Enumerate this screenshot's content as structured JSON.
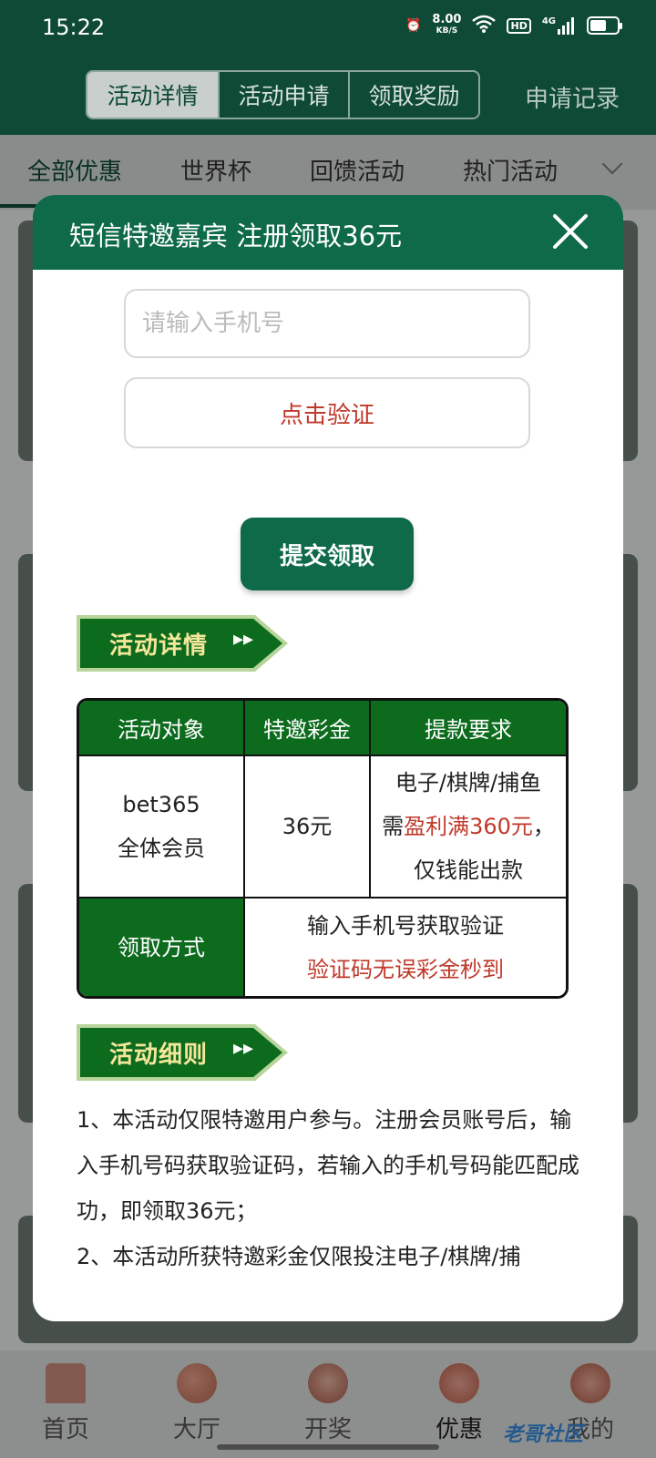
{
  "status_bar": {
    "time": "15:22",
    "net_speed_value": "8.00",
    "net_speed_unit": "KB/S",
    "hd_badge": "HD",
    "network": "4G",
    "battery_level": 0.6
  },
  "header": {
    "segments": [
      "活动详情",
      "活动申请",
      "领取奖励"
    ],
    "active_segment": "活动详情",
    "apply_record": "申请记录"
  },
  "categories": {
    "items": [
      "全部优惠",
      "世界杯",
      "回馈活动",
      "热门活动"
    ],
    "active": "全部优惠"
  },
  "bottom_nav": {
    "items": [
      "首页",
      "大厅",
      "开奖",
      "优惠",
      "我的"
    ],
    "active": "优惠"
  },
  "watermark": "老哥社区",
  "modal": {
    "title": "短信特邀嘉宾 注册领取36元",
    "phone_placeholder": "请输入手机号",
    "phone_value": "",
    "verify_label": "点击验证",
    "submit_label": "提交领取",
    "details_heading": "活动详情",
    "rules_heading": "活动细则",
    "table": {
      "headers": [
        "活动对象",
        "特邀彩金",
        "提款要求"
      ],
      "target_line1": "bet365",
      "target_line2": "全体会员",
      "bonus": "36元",
      "req_line1": "电子/棋牌/捕鱼",
      "req_line2_prefix": "需",
      "req_line2_red": "盈利满360元",
      "req_line2_suffix": "，",
      "req_line3": "仅钱能出款",
      "method_label": "领取方式",
      "method_line1": "输入手机号获取验证",
      "method_line2": "验证码无误彩金秒到"
    },
    "rules": [
      "1、本活动仅限特邀用户参与。注册会员账号后，输入手机号码获取验证码，若输入的手机号码能匹配成功，即领取36元；",
      "2、本活动所获特邀彩金仅限投注电子/棋牌/捕"
    ]
  },
  "colors": {
    "header_green": "#0e4a36",
    "modal_green": "#0e6a48",
    "table_green": "#0d6b1e",
    "accent_red": "#c0392b"
  }
}
